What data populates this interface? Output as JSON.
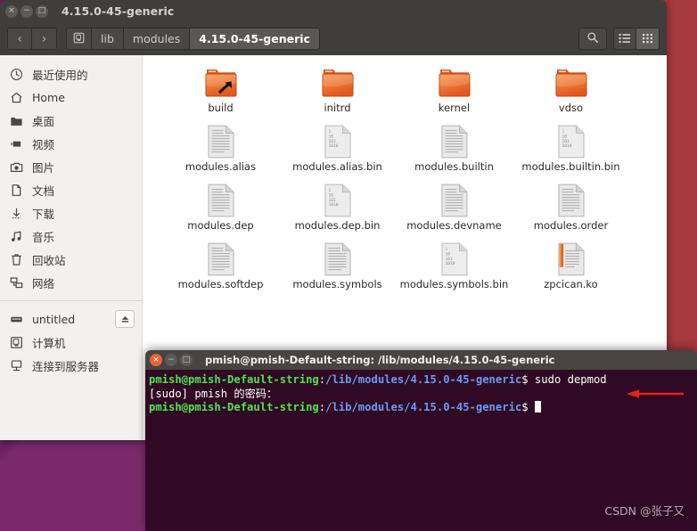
{
  "window": {
    "title": "4.15.0-45-generic",
    "controls": [
      {
        "name": "close",
        "glyph": "×"
      },
      {
        "name": "minimize",
        "glyph": "−"
      },
      {
        "name": "maximize",
        "glyph": "□"
      }
    ]
  },
  "toolbar": {
    "back_label": "‹",
    "forward_label": "›",
    "breadcrumb": [
      {
        "label": "",
        "icon": "computer-icon",
        "current": false
      },
      {
        "label": "lib",
        "current": false
      },
      {
        "label": "modules",
        "current": false
      },
      {
        "label": "4.15.0-45-generic",
        "current": true
      }
    ],
    "search_label": "search-icon",
    "list_view_label": "list-view-icon",
    "grid_view_label": "grid-view-icon",
    "active_view": "grid"
  },
  "sidebar": {
    "items": [
      {
        "label": "最近使用的",
        "icon": "clock-icon"
      },
      {
        "label": "Home",
        "icon": "home-icon"
      },
      {
        "label": "桌面",
        "icon": "folder-icon"
      },
      {
        "label": "视频",
        "icon": "video-icon"
      },
      {
        "label": "图片",
        "icon": "camera-icon"
      },
      {
        "label": "文档",
        "icon": "document-icon"
      },
      {
        "label": "下载",
        "icon": "download-icon"
      },
      {
        "label": "音乐",
        "icon": "music-icon"
      },
      {
        "label": "回收站",
        "icon": "trash-icon"
      },
      {
        "label": "网络",
        "icon": "network-icon"
      }
    ],
    "devices": [
      {
        "label": "untitled",
        "icon": "drive-icon",
        "eject": true,
        "eject_label": "⏏"
      },
      {
        "label": "计算机",
        "icon": "computer-icon",
        "eject": false
      },
      {
        "label": "连接到服务器",
        "icon": "server-icon",
        "eject": false
      }
    ]
  },
  "files": [
    {
      "name": "build",
      "type": "folder-symlink"
    },
    {
      "name": "initrd",
      "type": "folder"
    },
    {
      "name": "kernel",
      "type": "folder"
    },
    {
      "name": "vdso",
      "type": "folder"
    },
    {
      "name": "modules.alias",
      "type": "text"
    },
    {
      "name": "modules.alias.bin",
      "type": "binary"
    },
    {
      "name": "modules.builtin",
      "type": "text"
    },
    {
      "name": "modules.builtin.bin",
      "type": "binary"
    },
    {
      "name": "modules.dep",
      "type": "text"
    },
    {
      "name": "modules.dep.bin",
      "type": "binary"
    },
    {
      "name": "modules.devname",
      "type": "text"
    },
    {
      "name": "modules.order",
      "type": "text"
    },
    {
      "name": "modules.softdep",
      "type": "text"
    },
    {
      "name": "modules.symbols",
      "type": "text"
    },
    {
      "name": "modules.symbols.bin",
      "type": "binary"
    },
    {
      "name": "zpcican.ko",
      "type": "module"
    }
  ],
  "binary_icon_lines": [
    "1",
    "10",
    "101",
    "1010"
  ],
  "terminal": {
    "title": "pmish@pmish-Default-string: /lib/modules/4.15.0-45-generic",
    "controls": [
      {
        "name": "close",
        "glyph": "×"
      },
      {
        "name": "minimize",
        "glyph": "−"
      },
      {
        "name": "maximize",
        "glyph": "□"
      }
    ],
    "lines": [
      {
        "user": "pmish@pmish-Default-string",
        "colon": ":",
        "path": "/lib/modules/4.15.0-45-generic",
        "dollar": "$",
        "command": " sudo depmod"
      },
      {
        "plain": "[sudo] pmish 的密码："
      },
      {
        "user": "pmish@pmish-Default-string",
        "colon": ":",
        "path": "/lib/modules/4.15.0-45-generic",
        "dollar": "$",
        "command": " ",
        "cursor": true
      }
    ]
  },
  "annotation": {
    "arrow_color": "#e8201c",
    "arrow_name": "red-arrow-pointing-to-command"
  },
  "watermark": {
    "text": "CSDN @张子又"
  },
  "colors": {
    "titlebar": "#403e3c",
    "sidebar_bg": "#f3f1f0",
    "terminal_bg": "#300a24",
    "desktop": "#6d2060",
    "accent_orange": "#e8633a",
    "prompt_green": "#4ee44e",
    "prompt_blue": "#6a9bf4"
  }
}
